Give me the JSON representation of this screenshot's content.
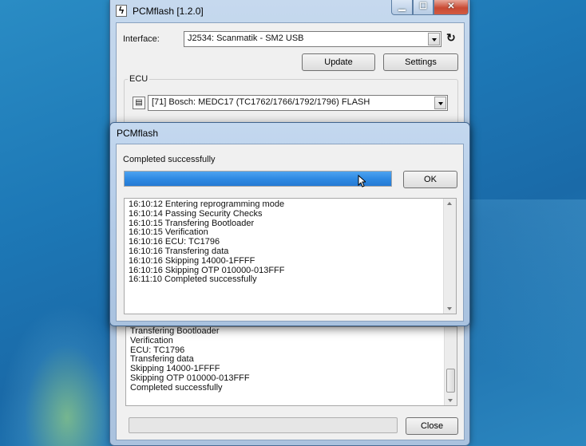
{
  "main_window": {
    "title": "PCMflash [1.2.0]",
    "app_icon": "lightning-icon",
    "interface_label": "Interface:",
    "interface_value": "J2534: Scanmatik - SM2 USB",
    "update_label": "Update",
    "settings_label": "Settings",
    "ecu_group_label": "ECU",
    "ecu_value": "[71] Bosch: MEDC17 (TC1762/1766/1792/1796) FLASH",
    "log_lines": [
      "Transfering Bootloader",
      "Verification",
      "ECU: TC1796",
      "Transfering data",
      "Skipping 14000-1FFFF",
      "Skipping OTP 010000-013FFF",
      "Completed successfully"
    ],
    "close_label": "Close"
  },
  "dialog": {
    "title": "PCMflash",
    "status": "Completed successfully",
    "progress_percent": 100,
    "ok_label": "OK",
    "log_lines": [
      "16:10:12 Entering reprogramming mode",
      "16:10:14 Passing Security Checks",
      "16:10:15 Transfering Bootloader",
      "16:10:15 Verification",
      "16:10:16 ECU: TC1796",
      "16:10:16 Transfering data",
      "16:10:16 Skipping 14000-1FFFF",
      "16:10:16 Skipping OTP 010000-013FFF",
      "16:11:10 Completed successfully"
    ]
  },
  "colors": {
    "progress_fill": "#2f8ae3",
    "desktop": "#1d78b6"
  }
}
